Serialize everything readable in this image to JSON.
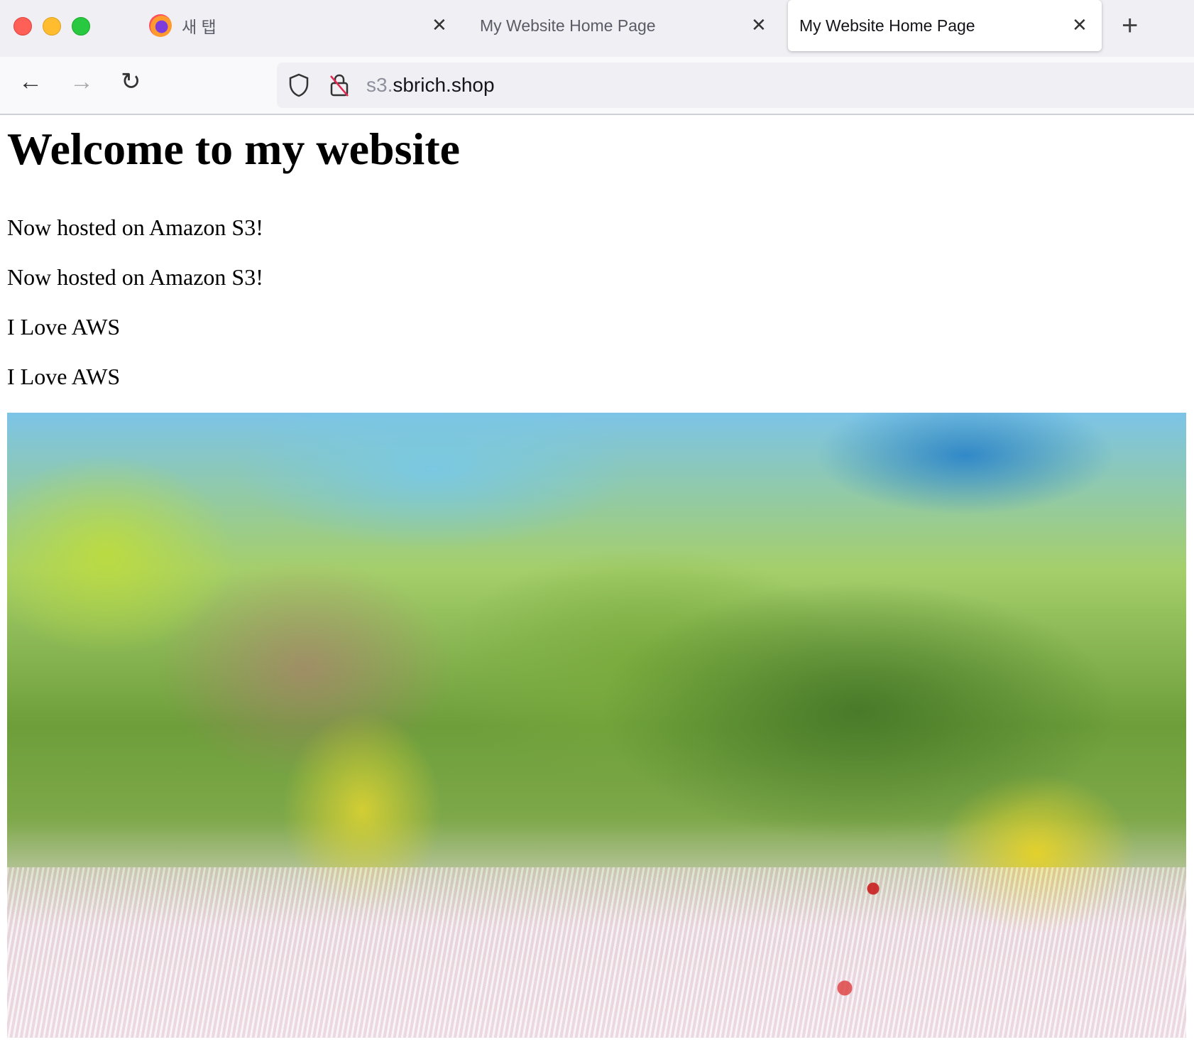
{
  "browser": {
    "tabs": [
      {
        "label": "새 탭",
        "icon": "firefox-icon"
      },
      {
        "label": "My Website Home Page"
      },
      {
        "label": "My Website Home Page",
        "active": true
      }
    ],
    "url_subdomain": "s3.",
    "url_domain": "sbrich.shop"
  },
  "page": {
    "heading": "Welcome to my website",
    "paragraphs": [
      "Now hosted on Amazon S3!",
      "Now hosted on Amazon S3!",
      "I Love AWS",
      "I Love AWS"
    ],
    "image_icon": "landscape-photo"
  }
}
